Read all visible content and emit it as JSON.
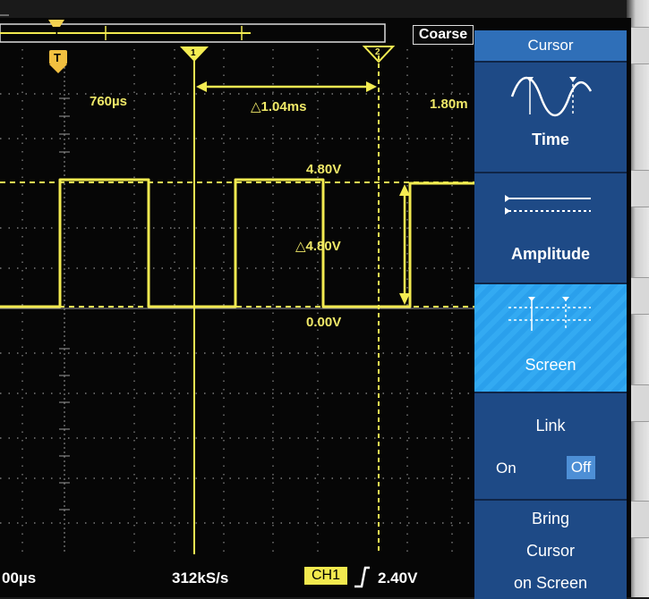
{
  "colors": {
    "trace": "#f2ea50",
    "cursor": "#f4ec52",
    "grid": "#8a8a8a",
    "menu_bg": "#1e4a86",
    "menu_active": "#2aa0ec",
    "menu_title": "#2f6fb8"
  },
  "top_bar": {
    "mode_label": "Coarse",
    "trigger_marker": "T"
  },
  "cursors": {
    "cursor1_label": "1",
    "cursor2_label": "2",
    "cursor1_time": "760µs",
    "delta_time": "△1.04ms",
    "cursor2_time": "1.80m",
    "upper_level": "4.80V",
    "delta_amplitude": "△4.80V",
    "lower_level": "0.00V"
  },
  "status_bar": {
    "timebase": "00µs",
    "sample_rate": "312kS/s",
    "channel": "CH1",
    "trigger_slope_icon": "rising-edge-icon",
    "trigger_level": "2.40V"
  },
  "menu": {
    "title": "Cursor",
    "items": [
      {
        "label": "Time",
        "icon": "sine-wave-cursor-icon",
        "active": false
      },
      {
        "label": "Amplitude",
        "icon": "horizontal-lines-icon",
        "active": false
      },
      {
        "label": "Screen",
        "icon": "screen-cursors-icon",
        "active": true
      },
      {
        "label": "Link",
        "options": [
          "On",
          "Off"
        ],
        "selected": "Off"
      },
      {
        "label_lines": [
          "Bring",
          "Cursor",
          "on Screen"
        ]
      }
    ]
  }
}
